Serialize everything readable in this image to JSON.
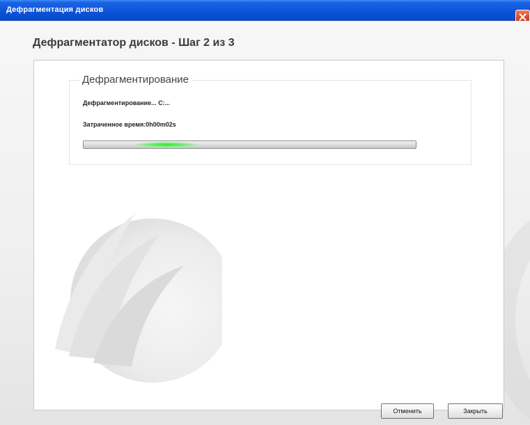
{
  "window": {
    "title": "Дефрагментация дисков"
  },
  "wizard": {
    "step_title": "Дефрагментатор дисков - Шаг 2 из 3"
  },
  "group": {
    "legend": "Дефрагментирование",
    "status": "Дефрагментирование... C:...",
    "elapsed_time": "Затраченное время:0h00m02s"
  },
  "progress": {
    "style": "marquee",
    "glow_center_fraction": 0.25
  },
  "buttons": {
    "cancel_label": "Отменить",
    "close_label": "Закрыть"
  },
  "colors": {
    "titlebar": "#0c53d8",
    "close_button": "#d54b2a",
    "progress_glow": "#2ee82e"
  },
  "icons": {
    "close": "close-icon",
    "logo": "product-logo"
  }
}
